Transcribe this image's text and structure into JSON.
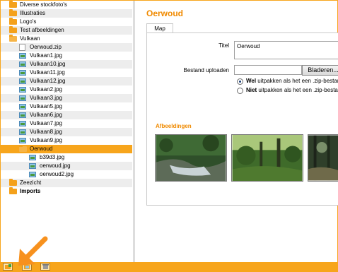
{
  "tree": {
    "items": [
      {
        "label": "Diverse stockfoto's",
        "type": "folder",
        "bold": false
      },
      {
        "label": "Illustraties",
        "type": "folder",
        "bold": false
      },
      {
        "label": "Logo's",
        "type": "folder",
        "bold": false
      },
      {
        "label": "Test afbeeldingen",
        "type": "folder",
        "bold": false
      },
      {
        "label": "Vulkaan",
        "type": "folder-open",
        "bold": false
      },
      {
        "label": "Oerwoud.zip",
        "type": "file",
        "bold": false
      },
      {
        "label": "Vulkaan1.jpg",
        "type": "image",
        "bold": false
      },
      {
        "label": "Vulkaan10.jpg",
        "type": "image",
        "bold": false
      },
      {
        "label": "Vulkaan11.jpg",
        "type": "image",
        "bold": false
      },
      {
        "label": "Vulkaan12.jpg",
        "type": "image",
        "bold": false
      },
      {
        "label": "Vulkaan2.jpg",
        "type": "image",
        "bold": false
      },
      {
        "label": "Vulkaan3.jpg",
        "type": "image",
        "bold": false
      },
      {
        "label": "Vulkaan5.jpg",
        "type": "image",
        "bold": false
      },
      {
        "label": "Vulkaan6.jpg",
        "type": "image",
        "bold": false
      },
      {
        "label": "Vulkaan7.jpg",
        "type": "image",
        "bold": false
      },
      {
        "label": "Vulkaan8.jpg",
        "type": "image",
        "bold": false
      },
      {
        "label": "Vulkaan9.jpg",
        "type": "image",
        "bold": false
      },
      {
        "label": "Oerwoud",
        "type": "folder-open",
        "bold": false,
        "selected": true
      },
      {
        "label": "b39d3.jpg",
        "type": "image",
        "bold": false
      },
      {
        "label": "oerwoud.jpg",
        "type": "image",
        "bold": false
      },
      {
        "label": "oerwoud2.jpg",
        "type": "image",
        "bold": false
      },
      {
        "label": "Zeezicht",
        "type": "folder",
        "bold": false
      },
      {
        "label": "Imports",
        "type": "folder",
        "bold": true
      }
    ]
  },
  "toolbar": {
    "buttons": [
      {
        "icon": "add-folder-icon"
      },
      {
        "icon": "add-image-icon"
      },
      {
        "icon": "delete-icon"
      }
    ]
  },
  "panel": {
    "title": "Oerwoud",
    "tab_label": "Map",
    "titel_label": "Titel",
    "titel_value": "Oerwoud",
    "upload_label": "Bestand uploaden",
    "upload_value": "",
    "browse_label": "Bladeren...",
    "radio_options": [
      {
        "strong": "Wel",
        "rest": " uitpakken als het een .zip-bestan",
        "checked": true
      },
      {
        "strong": "Niet",
        "rest": " uitpakken als het een .zip-bestan",
        "checked": false
      }
    ],
    "section_label": "Afbeeldingen"
  },
  "colors": {
    "accent": "#f7a51c",
    "title": "#f08a00",
    "selected_row": "#f7a51c"
  }
}
